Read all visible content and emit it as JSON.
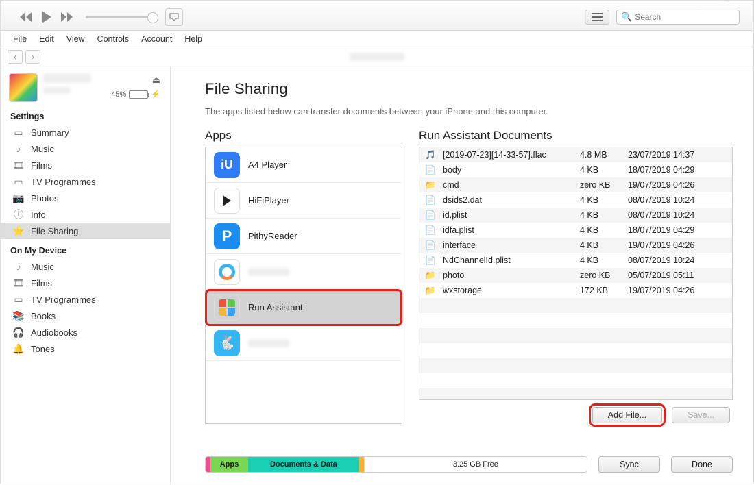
{
  "window_controls": {
    "min": "—",
    "max": "☐",
    "close": "✕"
  },
  "toolbar": {
    "search_placeholder": "Search"
  },
  "menubar": [
    "File",
    "Edit",
    "View",
    "Controls",
    "Account",
    "Help"
  ],
  "device": {
    "battery_text": "45%"
  },
  "sidebar": {
    "settings_header": "Settings",
    "settings_items": [
      {
        "label": "Summary",
        "icon": "summary"
      },
      {
        "label": "Music",
        "icon": "music"
      },
      {
        "label": "Films",
        "icon": "films"
      },
      {
        "label": "TV Programmes",
        "icon": "tv"
      },
      {
        "label": "Photos",
        "icon": "photos"
      },
      {
        "label": "Info",
        "icon": "info"
      },
      {
        "label": "File Sharing",
        "icon": "fileshare",
        "selected": true
      }
    ],
    "device_header": "On My Device",
    "device_items": [
      {
        "label": "Music",
        "icon": "music"
      },
      {
        "label": "Films",
        "icon": "films"
      },
      {
        "label": "TV Programmes",
        "icon": "tv"
      },
      {
        "label": "Books",
        "icon": "books"
      },
      {
        "label": "Audiobooks",
        "icon": "audiobooks"
      },
      {
        "label": "Tones",
        "icon": "tones"
      }
    ]
  },
  "page": {
    "title": "File Sharing",
    "subtitle": "The apps listed below can transfer documents between your iPhone and this computer.",
    "apps_header": "Apps",
    "docs_header": "Run Assistant Documents",
    "add_button": "Add File...",
    "save_button": "Save..."
  },
  "apps": [
    {
      "label": "A4 Player",
      "blur": false,
      "icon": "iu",
      "color": "#2f7bf5"
    },
    {
      "label": "HiFiPlayer",
      "blur": false,
      "icon": "play",
      "color": "#fff"
    },
    {
      "label": "PithyReader",
      "blur": false,
      "icon": "P",
      "color": "#1b8cf0"
    },
    {
      "label": "",
      "blur": true,
      "icon": "q",
      "color": "#fff"
    },
    {
      "label": "Run Assistant",
      "blur": false,
      "icon": "ra",
      "color": "#fff",
      "selected": true
    },
    {
      "label": "",
      "blur": true,
      "icon": "bunny",
      "color": "#35b6f2"
    }
  ],
  "documents": [
    {
      "name": "[2019-07-23][14-33-57].flac",
      "size": "4.8 MB",
      "date": "23/07/2019 14:37",
      "type": "audio"
    },
    {
      "name": "body",
      "size": "4 KB",
      "date": "18/07/2019 04:29",
      "type": "file"
    },
    {
      "name": "cmd",
      "size": "zero KB",
      "date": "19/07/2019 04:26",
      "type": "folder"
    },
    {
      "name": "dsids2.dat",
      "size": "4 KB",
      "date": "08/07/2019 10:24",
      "type": "file"
    },
    {
      "name": "id.plist",
      "size": "4 KB",
      "date": "08/07/2019 10:24",
      "type": "file"
    },
    {
      "name": "idfa.plist",
      "size": "4 KB",
      "date": "18/07/2019 04:29",
      "type": "file"
    },
    {
      "name": "interface",
      "size": "4 KB",
      "date": "19/07/2019 04:26",
      "type": "file"
    },
    {
      "name": "NdChannelId.plist",
      "size": "4 KB",
      "date": "08/07/2019 10:24",
      "type": "file"
    },
    {
      "name": "photo",
      "size": "zero KB",
      "date": "05/07/2019 05:11",
      "type": "folder"
    },
    {
      "name": "wxstorage",
      "size": "172 KB",
      "date": "19/07/2019 04:26",
      "type": "folder"
    }
  ],
  "storage": {
    "segments": [
      {
        "label": "",
        "color": "#e94f8a",
        "width": "1.2%"
      },
      {
        "label": "Apps",
        "color": "#7ad755",
        "width": "10%",
        "text": true
      },
      {
        "label": "Documents & Data",
        "color": "#1bcfb4",
        "width": "29%",
        "text": true
      },
      {
        "label": "",
        "color": "#f6b13c",
        "width": "1.3%"
      },
      {
        "label": "3.25 GB Free",
        "color": "#ffffff",
        "width": "58.5%",
        "text": true,
        "free": true
      }
    ]
  },
  "footer_buttons": {
    "sync": "Sync",
    "done": "Done"
  }
}
